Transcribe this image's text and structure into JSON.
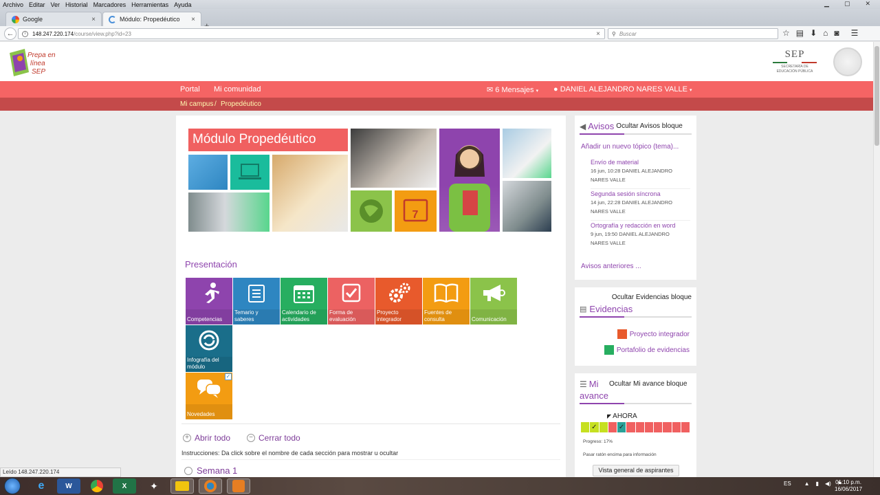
{
  "browser": {
    "menu": [
      "Archivo",
      "Editar",
      "Ver",
      "Historial",
      "Marcadores",
      "Herramientas",
      "Ayuda"
    ],
    "tabs": [
      {
        "label": "Google",
        "close": "×"
      },
      {
        "label": "Módulo: Propedéutico",
        "close": "×"
      }
    ],
    "new_tab": "+",
    "url_host": "148.247.220.174",
    "url_path": "/course/view.php?id=23",
    "url_clear": "×",
    "search_placeholder": "Buscar",
    "status": "Leído 148.247.220.174"
  },
  "header": {
    "logo_text": "Prepa en línea SEP",
    "sep_title": "SEP",
    "sep_sub1": "SECRETARÍA DE",
    "sep_sub2": "EDUCACIÓN PÚBLICA"
  },
  "nav": {
    "portal": "Portal",
    "comunidad": "Mi comunidad",
    "messages": "6 Mensajes",
    "user": "DANIEL ALEJANDRO NARES VALLE"
  },
  "breadcrumb": {
    "campus": "Mi campus",
    "sep": "/",
    "course": "Propedéutico"
  },
  "main": {
    "banner_title": "Módulo Propedéutico",
    "section_title": "Presentación",
    "activities": [
      {
        "label": "Competencias",
        "color": "#8e44ad",
        "icon": "runner"
      },
      {
        "label": "Temario y saberes",
        "color": "#2e86c1",
        "icon": "list"
      },
      {
        "label": "Calendario de actividades",
        "color": "#27ae60",
        "icon": "calendar"
      },
      {
        "label": "Forma de evaluación",
        "color": "#ec6262",
        "icon": "check"
      },
      {
        "label": "Proyecto integrador",
        "color": "#e85a2c",
        "icon": "gears"
      },
      {
        "label": "Fuentes de consulta",
        "color": "#f39c12",
        "icon": "book"
      },
      {
        "label": "Comunicación",
        "color": "#8bc34a",
        "icon": "megaphone"
      },
      {
        "label": "Infografía del módulo",
        "color": "#1a6e8a",
        "icon": "chart"
      },
      {
        "label": "Novedades",
        "color": "#f39c12",
        "icon": "chat"
      }
    ],
    "expand_all": "Abrir todo",
    "collapse_all": "Cerrar todo",
    "instructions": "Instrucciones: Da click sobre el nombre de cada sección para mostrar u ocultar",
    "week1": "Semana 1"
  },
  "avisos": {
    "title": "Avisos",
    "hide": "Ocultar Avisos bloque",
    "add": "Añadir un nuevo tópico (tema)...",
    "posts": [
      {
        "title": "Envío de material",
        "meta1": "16 jun, 10:28  DANIEL ALEJANDRO",
        "meta2": "NARES VALLE"
      },
      {
        "title": "Segunda sesión síncrona",
        "meta1": "14 jun, 22:28  DANIEL ALEJANDRO",
        "meta2": "NARES VALLE"
      },
      {
        "title": "Ortografía y redacción en word",
        "meta1": "9 jun, 19:50  DANIEL ALEJANDRO",
        "meta2": "NARES VALLE"
      }
    ],
    "older": "Avisos anteriores ..."
  },
  "evidencias": {
    "hide": "Ocultar Evidencias bloque",
    "title": "Evidencias",
    "items": [
      {
        "label": "Proyecto integrador",
        "color": "#e85a2c"
      },
      {
        "label": "Portafolio de evidencias",
        "color": "#27ae60"
      }
    ]
  },
  "avance": {
    "title1": "Mi",
    "title2": "avance",
    "hide": "Ocultar Mi avance bloque",
    "now": "AHORA",
    "progress": "Progreso: 17%",
    "progress_percent": 17,
    "hover": "Pasar ratón encima para información",
    "button": "Vista general de aspirantes",
    "cells": [
      "#c6e020",
      "#c6e020",
      "#c6e020",
      "#f06060",
      "#2aa198",
      "#f06060",
      "#f06060",
      "#f06060",
      "#f06060",
      "#f06060",
      "#f06060",
      "#f06060"
    ]
  },
  "taskbar": {
    "lang": "ES",
    "time": "01:10 p.m.",
    "date": "16/06/2017"
  }
}
